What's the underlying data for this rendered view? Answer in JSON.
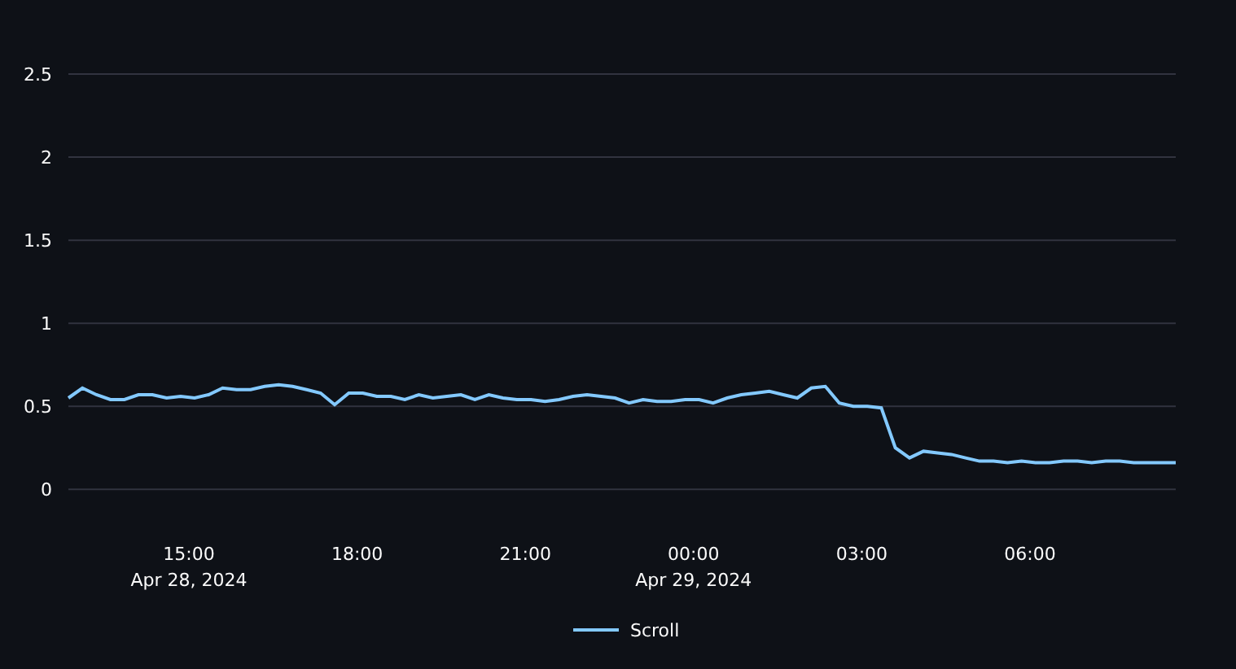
{
  "chart": {
    "chart_data": {
      "type": "line",
      "grid": true,
      "xlim": [
        "2024-04-28T12:51",
        "2024-04-29T08:36"
      ],
      "ylim": [
        0,
        2.5
      ],
      "x": [
        "2024-04-28T12:51",
        "2024-04-28T13:06",
        "2024-04-28T13:21",
        "2024-04-28T13:36",
        "2024-04-28T13:51",
        "2024-04-28T14:06",
        "2024-04-28T14:21",
        "2024-04-28T14:36",
        "2024-04-28T14:51",
        "2024-04-28T15:06",
        "2024-04-28T15:21",
        "2024-04-28T15:36",
        "2024-04-28T15:51",
        "2024-04-28T16:06",
        "2024-04-28T16:21",
        "2024-04-28T16:36",
        "2024-04-28T16:51",
        "2024-04-28T17:06",
        "2024-04-28T17:21",
        "2024-04-28T17:36",
        "2024-04-28T17:51",
        "2024-04-28T18:06",
        "2024-04-28T18:21",
        "2024-04-28T18:36",
        "2024-04-28T18:51",
        "2024-04-28T19:06",
        "2024-04-28T19:21",
        "2024-04-28T19:36",
        "2024-04-28T19:51",
        "2024-04-28T20:06",
        "2024-04-28T20:21",
        "2024-04-28T20:36",
        "2024-04-28T20:51",
        "2024-04-28T21:06",
        "2024-04-28T21:21",
        "2024-04-28T21:36",
        "2024-04-28T21:51",
        "2024-04-28T22:06",
        "2024-04-28T22:21",
        "2024-04-28T22:36",
        "2024-04-28T22:51",
        "2024-04-28T23:06",
        "2024-04-28T23:21",
        "2024-04-28T23:36",
        "2024-04-28T23:51",
        "2024-04-29T00:06",
        "2024-04-29T00:21",
        "2024-04-29T00:36",
        "2024-04-29T00:51",
        "2024-04-29T01:06",
        "2024-04-29T01:21",
        "2024-04-29T01:36",
        "2024-04-29T01:51",
        "2024-04-29T02:06",
        "2024-04-29T02:21",
        "2024-04-29T02:36",
        "2024-04-29T02:51",
        "2024-04-29T03:06",
        "2024-04-29T03:21",
        "2024-04-29T03:36",
        "2024-04-29T03:51",
        "2024-04-29T04:06",
        "2024-04-29T04:21",
        "2024-04-29T04:36",
        "2024-04-29T04:51",
        "2024-04-29T05:06",
        "2024-04-29T05:21",
        "2024-04-29T05:36",
        "2024-04-29T05:51",
        "2024-04-29T06:06",
        "2024-04-29T06:21",
        "2024-04-29T06:36",
        "2024-04-29T06:51",
        "2024-04-29T07:06",
        "2024-04-29T07:21",
        "2024-04-29T07:36",
        "2024-04-29T07:51",
        "2024-04-29T08:06",
        "2024-04-29T08:21",
        "2024-04-29T08:36"
      ],
      "series": [
        {
          "name": "Scroll",
          "color": "#83c9ff",
          "values": [
            0.55,
            0.61,
            0.57,
            0.54,
            0.54,
            0.57,
            0.57,
            0.55,
            0.56,
            0.55,
            0.57,
            0.61,
            0.6,
            0.6,
            0.62,
            0.63,
            0.62,
            0.6,
            0.58,
            0.51,
            0.58,
            0.58,
            0.56,
            0.56,
            0.54,
            0.57,
            0.55,
            0.56,
            0.57,
            0.54,
            0.57,
            0.55,
            0.54,
            0.54,
            0.53,
            0.54,
            0.56,
            0.57,
            0.56,
            0.55,
            0.52,
            0.54,
            0.53,
            0.53,
            0.54,
            0.54,
            0.52,
            0.55,
            0.57,
            0.58,
            0.59,
            0.57,
            0.55,
            0.61,
            0.62,
            0.52,
            0.5,
            0.5,
            0.49,
            0.25,
            0.19,
            0.23,
            0.22,
            0.21,
            0.19,
            0.17,
            0.17,
            0.16,
            0.17,
            0.16,
            0.16,
            0.17,
            0.17,
            0.16,
            0.17,
            0.17,
            0.16,
            0.16,
            0.16,
            0.16
          ]
        }
      ],
      "xticks": [
        {
          "value": "2024-04-28T15:00",
          "label": "15:00\nApr 28, 2024"
        },
        {
          "value": "2024-04-28T18:00",
          "label": "18:00"
        },
        {
          "value": "2024-04-28T21:00",
          "label": "21:00"
        },
        {
          "value": "2024-04-29T00:00",
          "label": "00:00\nApr 29, 2024"
        },
        {
          "value": "2024-04-29T03:00",
          "label": "03:00"
        },
        {
          "value": "2024-04-29T06:00",
          "label": "06:00"
        }
      ],
      "yticks": [
        {
          "value": 0,
          "label": "0"
        },
        {
          "value": 0.5,
          "label": "0.5"
        },
        {
          "value": 1,
          "label": "1"
        },
        {
          "value": 1.5,
          "label": "1.5"
        },
        {
          "value": 2,
          "label": "2"
        },
        {
          "value": 2.5,
          "label": "2.5"
        }
      ]
    }
  }
}
